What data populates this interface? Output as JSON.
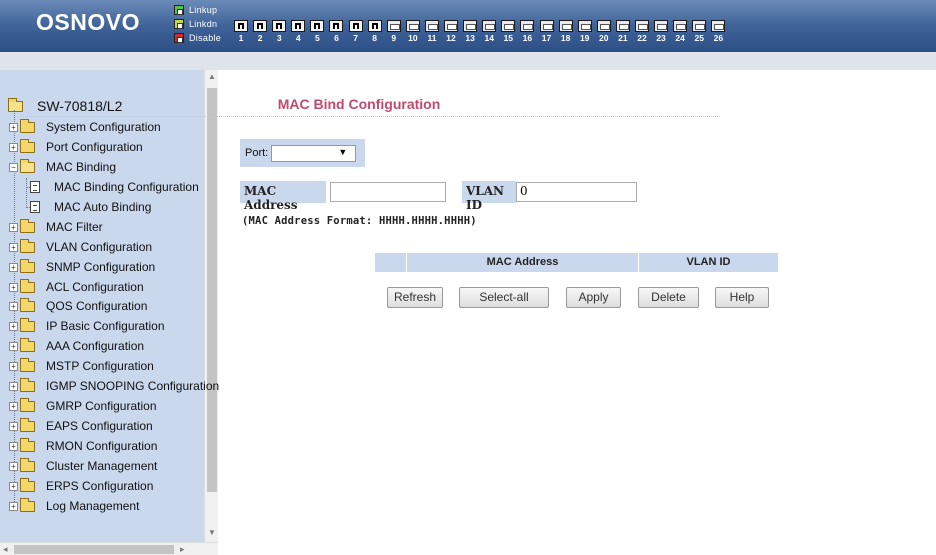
{
  "header": {
    "brand": "OSNOVO",
    "legend": [
      {
        "label": "Linkup",
        "color": "#58c14a"
      },
      {
        "label": "Linkdn",
        "color": "#c6d84a"
      },
      {
        "label": "Disable",
        "color": "#d12a2a"
      }
    ],
    "ports": [
      "1",
      "2",
      "3",
      "4",
      "5",
      "6",
      "7",
      "8",
      "9",
      "10",
      "11",
      "12",
      "13",
      "14",
      "15",
      "16",
      "17",
      "18",
      "19",
      "20",
      "21",
      "22",
      "23",
      "24",
      "25",
      "26"
    ],
    "ports_up_count": 8
  },
  "sidebar": {
    "root": "SW-70818/L2",
    "items": [
      {
        "label": "System Configuration"
      },
      {
        "label": "Port Configuration"
      },
      {
        "label": "MAC Binding"
      },
      {
        "label": "MAC Binding Configuration"
      },
      {
        "label": "MAC Auto Binding"
      },
      {
        "label": "MAC Filter"
      },
      {
        "label": "VLAN Configuration"
      },
      {
        "label": "SNMP Configuration"
      },
      {
        "label": "ACL Configuration"
      },
      {
        "label": "QOS Configuration"
      },
      {
        "label": "IP Basic Configuration"
      },
      {
        "label": "AAA Configuration"
      },
      {
        "label": "MSTP Configuration"
      },
      {
        "label": "IGMP SNOOPING Configuration"
      },
      {
        "label": "GMRP Configuration"
      },
      {
        "label": "EAPS Configuration"
      },
      {
        "label": "RMON Configuration"
      },
      {
        "label": "Cluster Management"
      },
      {
        "label": "ERPS Configuration"
      },
      {
        "label": "Log Management"
      }
    ]
  },
  "main": {
    "title": "MAC Bind Configuration",
    "port_label": "Port:",
    "port_value": "",
    "mac_label": "MAC Address",
    "mac_value": "",
    "vlan_label": "VLAN ID",
    "vlan_value": "0",
    "format_note": "(MAC Address Format: HHHH.HHHH.HHHH)",
    "table_headers": [
      "",
      "MAC Address",
      "VLAN ID"
    ],
    "buttons": {
      "refresh": "Refresh",
      "select_all": "Select-all",
      "apply": "Apply",
      "delete": "Delete",
      "help": "Help"
    }
  },
  "colors": {
    "header_blue": "#3f6398",
    "panel_blue": "#c9d8ec",
    "title_pink": "#c04a6d"
  }
}
